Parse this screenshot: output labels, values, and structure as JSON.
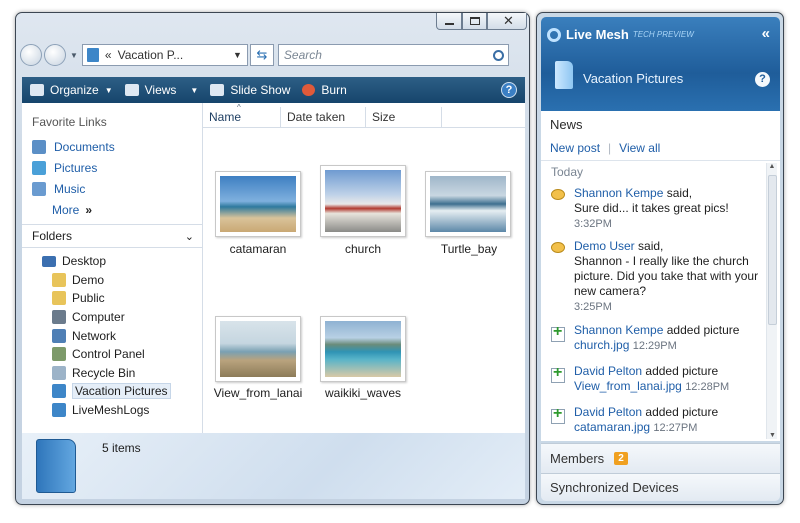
{
  "explorer": {
    "address": "Vacation P...",
    "address_prefix": "«",
    "search_placeholder": "Search",
    "toolbar": {
      "organize": "Organize",
      "views": "Views",
      "slideshow": "Slide Show",
      "burn": "Burn"
    },
    "favorite_links_title": "Favorite Links",
    "favorite_links": [
      "Documents",
      "Pictures",
      "Music"
    ],
    "more": "More",
    "folders_title": "Folders",
    "tree": [
      "Desktop",
      "Demo",
      "Public",
      "Computer",
      "Network",
      "Control Panel",
      "Recycle Bin",
      "Vacation Pictures",
      "LiveMeshLogs"
    ],
    "columns": [
      "Name",
      "Date taken",
      "Size"
    ],
    "files": [
      "catamaran",
      "church",
      "Turtle_bay",
      "View_from_lanai",
      "waikiki_waves"
    ],
    "status_count": "5 items"
  },
  "mesh": {
    "brand": "Live Mesh",
    "brand_sub": "TECH PREVIEW",
    "folder_title": "Vacation Pictures",
    "news_title": "News",
    "new_post": "New post",
    "view_all": "View all",
    "section_today": "Today",
    "feed": [
      {
        "user": "Shannon Kempe",
        "action": "said,",
        "text": "Sure did... it takes great pics!",
        "time": "3:32PM"
      },
      {
        "user": "Demo User",
        "action": "said,",
        "text": "Shannon - I really like the church picture. Did you take that with your new camera?",
        "time": "3:25PM"
      },
      {
        "user": "Shannon Kempe",
        "action": "added picture",
        "file": "church.jpg",
        "time": "12:29PM"
      },
      {
        "user": "David Pelton",
        "action": "added picture",
        "file": "View_from_lanai.jpg",
        "time": "12:28PM"
      },
      {
        "user": "David Pelton",
        "action": "added picture",
        "file": "catamaran.jpg",
        "time": "12:27PM"
      }
    ],
    "members_label": "Members",
    "members_count": "2",
    "synced_devices_label": "Synchronized Devices"
  }
}
